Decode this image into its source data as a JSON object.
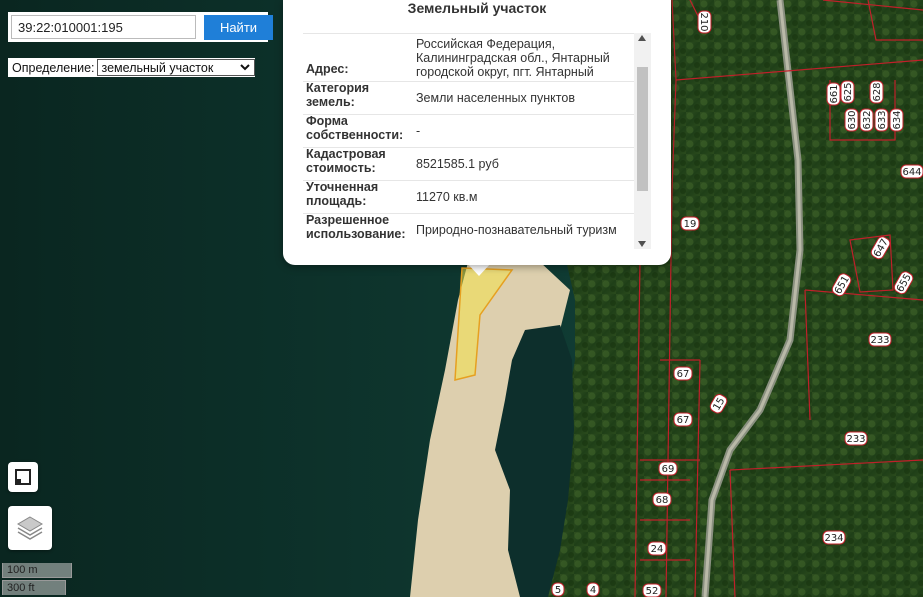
{
  "search": {
    "value": "39:22:010001:195",
    "button_label": "Найти"
  },
  "definition": {
    "label": "Определение:",
    "selected": "земельный участок"
  },
  "popup": {
    "title": "Земельный участок",
    "properties": [
      {
        "label": "Адрес:",
        "value": "Российская Федерация, Калининградская обл., Янтарный городской округ, пгт. Янтарный"
      },
      {
        "label": "Категория земель:",
        "value": "Земли населенных пунктов"
      },
      {
        "label": "Форма собственности:",
        "value": "-"
      },
      {
        "label": "Кадастровая стоимость:",
        "value": "8521585.1 руб"
      },
      {
        "label": "Уточненная площадь:",
        "value": "11270 кв.м"
      },
      {
        "label": "Разрешенное использование:",
        "value": "Природно-познавательный туризм"
      }
    ]
  },
  "scale": {
    "metric": "100 m",
    "imperial": "300 ft"
  },
  "parcel_labels": [
    "210",
    "661",
    "625",
    "628",
    "630",
    "632",
    "633",
    "634",
    "644",
    "647",
    "651",
    "655",
    "19",
    "233",
    "67",
    "67",
    "15",
    "233",
    "69",
    "68",
    "24",
    "234",
    "5",
    "4",
    "52"
  ],
  "colors": {
    "parcel_border": "#c0202a",
    "selected_parcel": "#f3e14a",
    "search_button": "#1f7fd8",
    "sea": "#0f3a32"
  },
  "icons": {
    "fullscreen": "fullscreen-icon",
    "layers": "layers-icon"
  }
}
